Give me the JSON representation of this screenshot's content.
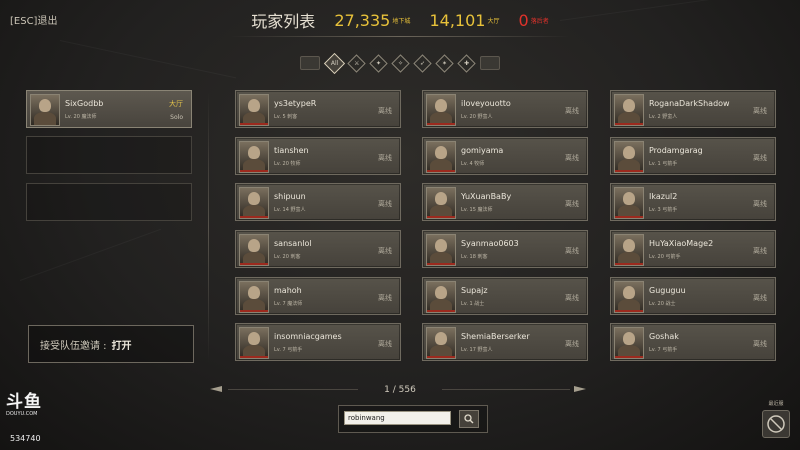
{
  "top": {
    "esc_label": "[ESC]退出"
  },
  "header": {
    "title": "玩家列表",
    "dungeon_count": "27,335",
    "dungeon_label": "地下城",
    "lobby_count": "14,101",
    "lobby_label": "大厅",
    "zero_count": "0",
    "zero_label": "落后者",
    "colors": {
      "dungeon": "#e8c23a",
      "lobby": "#e8c23a",
      "zero": "#e0322b"
    }
  },
  "filters": {
    "items": [
      {
        "icon": "all-icon",
        "glyph": "All",
        "active": true
      },
      {
        "icon": "class-fighter-icon",
        "glyph": "⚔",
        "active": false
      },
      {
        "icon": "class-barbarian-icon",
        "glyph": "✦",
        "active": false
      },
      {
        "icon": "class-rogue-icon",
        "glyph": "✧",
        "active": false
      },
      {
        "icon": "class-ranger-icon",
        "glyph": "➶",
        "active": false
      },
      {
        "icon": "class-wizard-icon",
        "glyph": "✶",
        "active": false
      },
      {
        "icon": "class-cleric-icon",
        "glyph": "✚",
        "active": false
      }
    ]
  },
  "party": {
    "member": {
      "name": "SixGodbb",
      "sub": "Lv. 20 魔法师",
      "location": "大厅",
      "mode": "Solo"
    }
  },
  "invite": {
    "label": "接受队伍邀请 :",
    "value": "打开"
  },
  "players": [
    {
      "name": "ys3etypeR",
      "sub": "Lv. 5 刺客",
      "status": "离线"
    },
    {
      "name": "iloveyouotto",
      "sub": "Lv. 20 野蛮人",
      "status": "离线"
    },
    {
      "name": "RoganaDarkShadow",
      "sub": "Lv. 2 野蛮人",
      "status": "离线"
    },
    {
      "name": "tianshen",
      "sub": "Lv. 20 牧师",
      "status": "离线"
    },
    {
      "name": "gomiyama",
      "sub": "Lv. 4 牧师",
      "status": "离线"
    },
    {
      "name": "Prodamgarag",
      "sub": "Lv. 1 弓箭手",
      "status": "离线"
    },
    {
      "name": "shipuun",
      "sub": "Lv. 14 野蛮人",
      "status": "离线"
    },
    {
      "name": "YuXuanBaBy",
      "sub": "Lv. 15 魔法师",
      "status": "离线"
    },
    {
      "name": "Ikazul2",
      "sub": "Lv. 3 弓箭手",
      "status": "离线"
    },
    {
      "name": "sansanlol",
      "sub": "Lv. 20 刺客",
      "status": "离线"
    },
    {
      "name": "Syanmao0603",
      "sub": "Lv. 18 刺客",
      "status": "离线"
    },
    {
      "name": "HuYaXiaoMage2",
      "sub": "Lv. 20 弓箭手",
      "status": "离线"
    },
    {
      "name": "mahoh",
      "sub": "Lv. 7 魔法师",
      "status": "离线"
    },
    {
      "name": "Supajz",
      "sub": "Lv. 1 战士",
      "status": "离线"
    },
    {
      "name": "Guguguu",
      "sub": "Lv. 20 战士",
      "status": "离线"
    },
    {
      "name": "insomniacgames",
      "sub": "Lv. 7 弓箭手",
      "status": "离线"
    },
    {
      "name": "ShemiaBerserker",
      "sub": "Lv. 17 野蛮人",
      "status": "离线"
    },
    {
      "name": "Goshak",
      "sub": "Lv. 7 弓箭手",
      "status": "离线"
    }
  ],
  "pagination": {
    "label": "1 / 556"
  },
  "search": {
    "value": "robinwang"
  },
  "branding": {
    "logo_main": "斗鱼",
    "logo_sub": "DOUYU.COM",
    "room_id": "534740"
  },
  "shortcut": {
    "label": "最近服"
  }
}
